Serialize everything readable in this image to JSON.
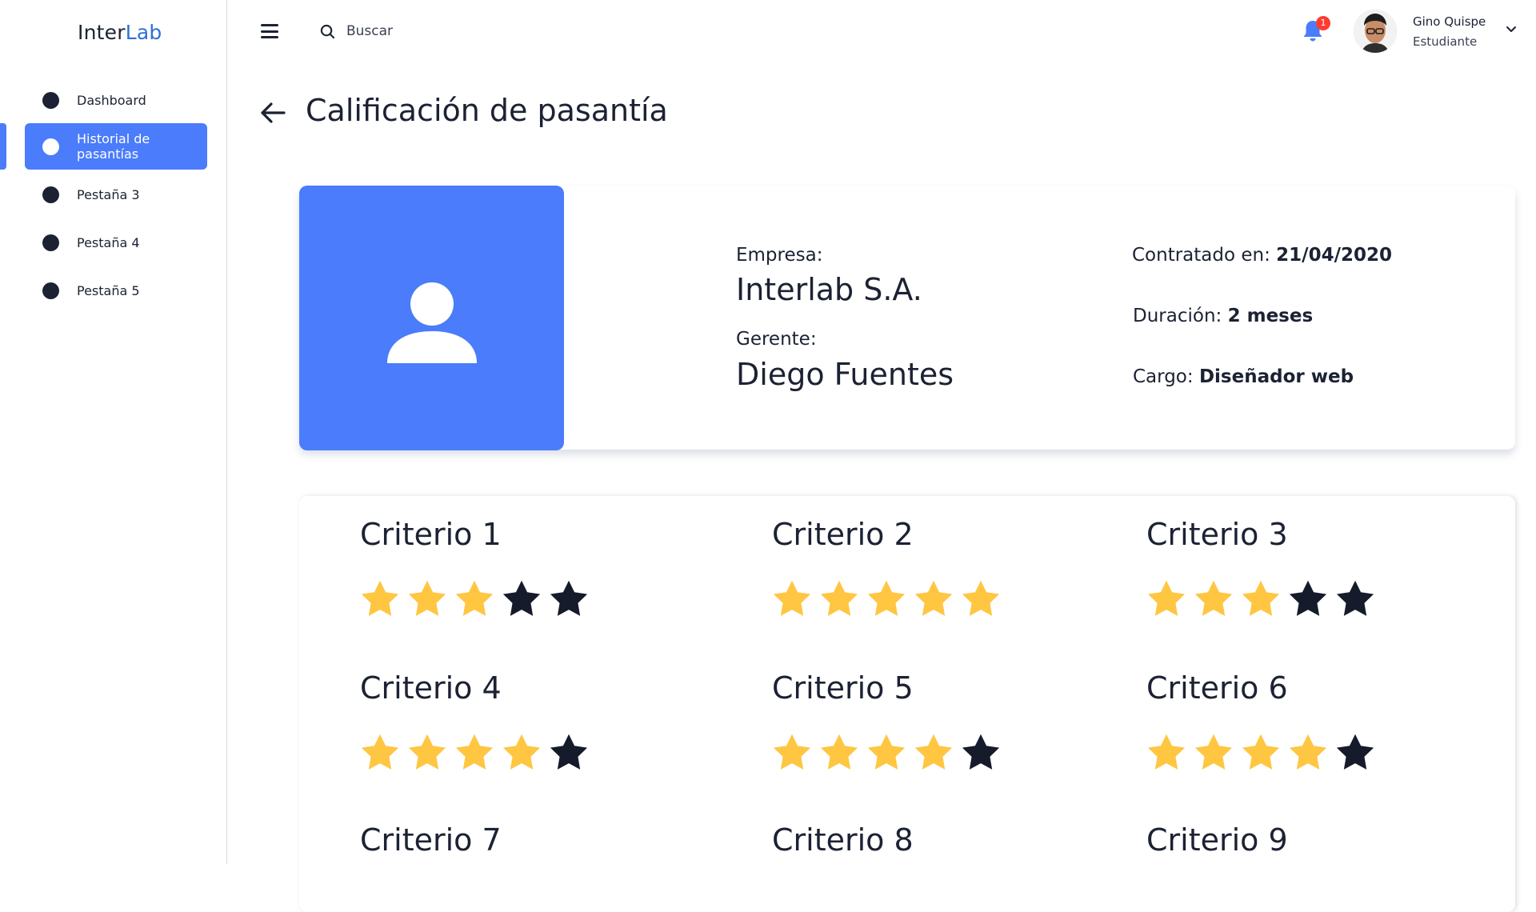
{
  "app": {
    "logo_part1": "Inter",
    "logo_part2": "Lab"
  },
  "sidebar": {
    "items": [
      {
        "label": "Dashboard",
        "active": false
      },
      {
        "label": "Historial de pasantías",
        "active": true
      },
      {
        "label": "Pestaña 3",
        "active": false
      },
      {
        "label": "Pestaña 4",
        "active": false
      },
      {
        "label": "Pestaña 5",
        "active": false
      }
    ]
  },
  "topbar": {
    "search_label": "Buscar",
    "notifications_count": "1",
    "user_name": "Gino Quispe",
    "user_role": "Estudiante"
  },
  "page": {
    "title": "Calificación de pasantía"
  },
  "internship": {
    "company_label": "Empresa:",
    "company": "Interlab S.A.",
    "manager_label": "Gerente:",
    "manager": "Diego Fuentes",
    "hired_label": "Contratado en:",
    "hired_date": "21/04/2020",
    "duration_label": "Duración:",
    "duration": "2 meses",
    "role_label": "Cargo:",
    "role": "Diseñador web"
  },
  "ratings": {
    "max_stars": 5,
    "criteria": [
      {
        "name": "Criterio 1",
        "score": 3
      },
      {
        "name": "Criterio 2",
        "score": 5
      },
      {
        "name": "Criterio 3",
        "score": 3
      },
      {
        "name": "Criterio 4",
        "score": 4
      },
      {
        "name": "Criterio 5",
        "score": 4
      },
      {
        "name": "Criterio 6",
        "score": 4
      },
      {
        "name": "Criterio 7",
        "score": null
      },
      {
        "name": "Criterio 8",
        "score": null
      },
      {
        "name": "Criterio 9",
        "score": null
      }
    ]
  },
  "colors": {
    "accent": "#4a7cfb",
    "star_filled": "#ffc642",
    "star_empty": "#151b2b",
    "text": "#1c2233",
    "badge": "#ff3b30"
  }
}
